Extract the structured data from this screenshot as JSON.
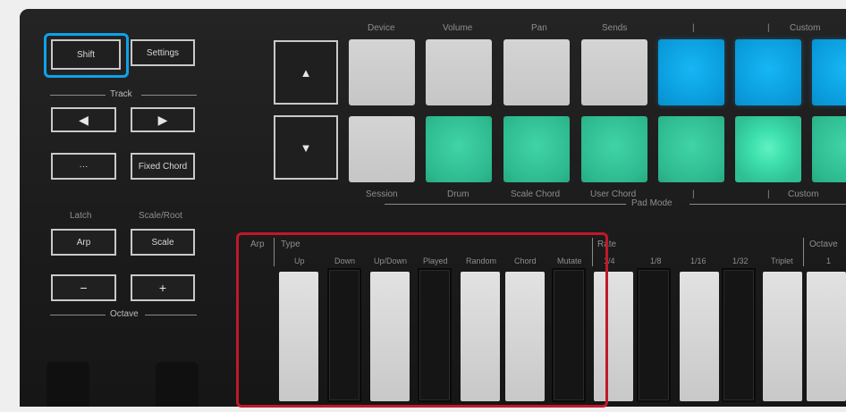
{
  "top_pad_labels": [
    "Device",
    "Volume",
    "Pan",
    "Sends",
    "|",
    "|",
    "Custom"
  ],
  "bottom_pad_labels": [
    "Session",
    "Drum",
    "Scale Chord",
    "User Chord",
    "|",
    "|",
    "Custom"
  ],
  "pad_mode_label": "Pad Mode",
  "left": {
    "shift": "Shift",
    "settings": "Settings",
    "track": "Track",
    "left_arrow": "◀",
    "right_arrow": "▶",
    "dots": "···",
    "fixed_chord": "Fixed Chord",
    "latch": "Latch",
    "scale_root": "Scale/Root",
    "arp": "Arp",
    "scale": "Scale",
    "minus": "−",
    "plus": "+",
    "octave": "Octave"
  },
  "pad_arrows": {
    "up": "▲",
    "down": "▼"
  },
  "arp_labels": {
    "arp": "Arp",
    "type": "Type",
    "rate": "Rate",
    "octave": "Octave",
    "octave_value": "1"
  },
  "key_labels": [
    "Up",
    "Down",
    "Up/Down",
    "Played",
    "Random",
    "Chord",
    "Mutate",
    "1/4",
    "1/8",
    "1/16",
    "1/32",
    "Triplet"
  ],
  "pads": {
    "top_colors": [
      "grey",
      "grey",
      "grey",
      "grey",
      "blue",
      "blue",
      "blue"
    ],
    "bottom_colors": [
      "grey",
      "green",
      "green",
      "green",
      "green",
      "bright",
      "green"
    ]
  },
  "colors": {
    "highlight_blue": "#0ea2e8",
    "highlight_red": "#c0182b",
    "panel": "#1d1d1d"
  }
}
